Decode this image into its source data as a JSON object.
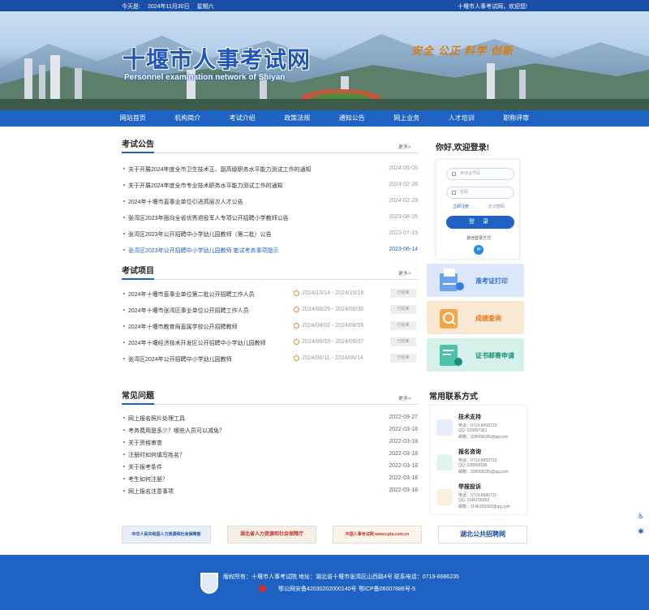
{
  "topbar": {
    "today_label": "今天是:",
    "date": "2024年11月30日",
    "weekday": "星期六",
    "welcome": "十堰市人事考试网，欢迎您!"
  },
  "banner": {
    "title": "十堰市人事考试网",
    "subtitle": "Personnel examination network of Shiyan",
    "slogan": "安全 公正 科学 创新"
  },
  "nav": [
    "网站首页",
    "机构简介",
    "考试介绍",
    "政策法规",
    "通知公告",
    "网上业务",
    "人才培训",
    "职称评审"
  ],
  "notices": {
    "title": "考试公告",
    "more": "更多>",
    "items": [
      {
        "title": "关于开展2024年度全市卫生技术正、副高级职务水平能力测试工作的通知",
        "date": "2024-05-06"
      },
      {
        "title": "关于开展2024年度全市专业技术职务水平能力测试工作的通知",
        "date": "2024-02-28"
      },
      {
        "title": "2024年十堰市直事业单位引进高层次人才公告",
        "date": "2024-02-28"
      },
      {
        "title": "张湾区2023年面向全省优秀退役军人专项公开招聘小学教师公告",
        "date": "2023-08-26"
      },
      {
        "title": "张湾区2023年公开招聘中小学幼儿园教师（第二批）公告",
        "date": "2023-07-19"
      },
      {
        "title": "张湾区2023年公开招聘中小学幼儿园教师 笔试考务事项提示",
        "date": "2023-06-14"
      }
    ]
  },
  "projects": {
    "title": "考试项目",
    "more": "更多>",
    "items": [
      {
        "title": "2024年十堰市直事业单位第二批公开招聘工作人员",
        "period": "2024/10/14 - 2024/10/18",
        "status": "已结束"
      },
      {
        "title": "2024年十堰市张湾区事业单位公开招聘工作人员",
        "period": "2024/08/26 - 2024/08/30",
        "status": "已结束"
      },
      {
        "title": "2024年十堰市教育局直属学校公开招聘教师",
        "period": "2024/08/02 - 2024/08/06",
        "status": "已结束"
      },
      {
        "title": "2024年十堰经济技术开发区公开招聘中小学幼儿园教师",
        "period": "2024/06/03 - 2024/06/07",
        "status": "已结束"
      },
      {
        "title": "张湾区2024年公开招聘中小学幼儿园教师",
        "period": "2024/06/11 - 2024/06/14",
        "status": "已结束"
      }
    ]
  },
  "faq": {
    "title": "常见问题",
    "more": "更多>",
    "items": [
      {
        "title": "网上报名照片处理工具",
        "date": "2022-09-27"
      },
      {
        "title": "考务费用是多少？哪些人员可以减免？",
        "date": "2022-03-18"
      },
      {
        "title": "关于资格审查",
        "date": "2022-03-18"
      },
      {
        "title": "注册时如何填写姓名？",
        "date": "2022-03-18"
      },
      {
        "title": "关于报考条件",
        "date": "2022-03-18"
      },
      {
        "title": "考生如何注册？",
        "date": "2022-03-18"
      },
      {
        "title": "网上报名注意事项",
        "date": "2022-03-18"
      }
    ]
  },
  "login": {
    "heading": "你好,欢迎登录!",
    "id_placeholder": "身份证号码",
    "pwd_placeholder": "密码",
    "register": "立即注册",
    "forgot": "忘记密码",
    "button": "登 录",
    "other": "其他登录方式",
    "qq_icon": "qq-icon"
  },
  "cards": [
    {
      "label": "准考证打印",
      "color": "#2f6ed6",
      "bg": "#dbe8fb"
    },
    {
      "label": "成绩查询",
      "color": "#e07a16",
      "bg": "#fbe8d2"
    },
    {
      "label": "证书邮寄申请",
      "color": "#1a8f7c",
      "bg": "#d6f0ea"
    }
  ],
  "contact": {
    "title": "常用联系方式",
    "items": [
      {
        "name": "技术支持",
        "phone": "电话：0719-8650723",
        "qq": "QQ: 329997361",
        "email": "邮箱：328068185@qq.com"
      },
      {
        "name": "报名咨询",
        "phone": "电话：0719-8650723",
        "qq": "QQ: 328068185",
        "email": "邮箱：328068185@qq.com"
      },
      {
        "name": "举报投诉",
        "phone": "电话：0719-8686721",
        "qq": "QQ: 1146156392",
        "email": "邮箱：1146156392@qq.com"
      }
    ]
  },
  "links": [
    "中华人民共和国人力资源和社会保障部",
    "湖北省人力资源和社会保障厅",
    "中国人事考试网 www.cpta.com.cn",
    "湖北公共招聘网"
  ],
  "footer": {
    "line1": "版权所有：十堰市人事考试院  地址：湖北省十堰市张湾区山西路4号  联系电话：0719-8686235",
    "police": "鄂公网安备42030202000140号",
    "icp": "鄂ICP备06007886号-5"
  },
  "colors": {
    "primary": "#1e63c4",
    "topbar": "#1a4fa8",
    "accent": "#e07a16"
  }
}
